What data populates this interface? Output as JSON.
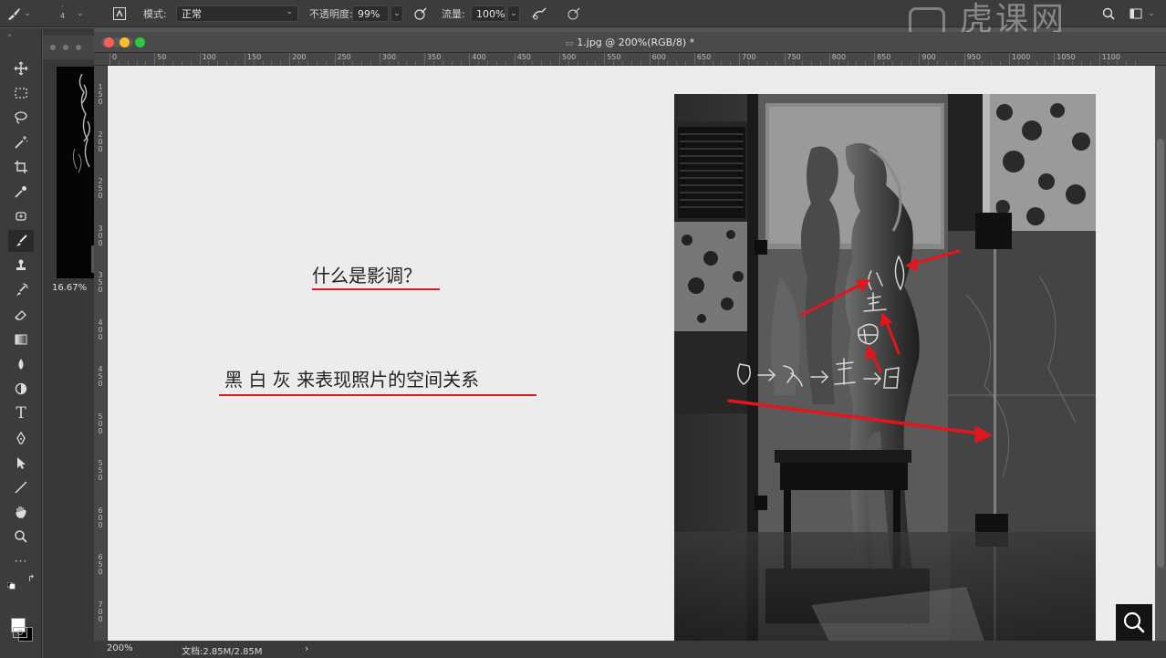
{
  "options_bar": {
    "mode_label": "模式:",
    "mode_value": "正常",
    "opacity_label": "不透明度:",
    "opacity_value": "99%",
    "flow_label": "流量:",
    "flow_value": "100%",
    "brush_size": "4"
  },
  "watermark": "虎课网",
  "document": {
    "title": "1.jpg @ 200%(RGB/8) *",
    "traffic_colors": {
      "close": "#fc5f57",
      "minimize": "#fdbc2e",
      "zoom": "#2ac840"
    }
  },
  "ruler_top": [
    "0",
    "50",
    "100",
    "150",
    "200",
    "250",
    "300",
    "350",
    "400",
    "450",
    "500",
    "550",
    "600",
    "650",
    "700",
    "750",
    "800",
    "850",
    "900",
    "950",
    "1000",
    "1050",
    "1100"
  ],
  "ruler_left": [
    "1 5 0",
    "2 0 0",
    "2 5 0",
    "3 0 0",
    "3 5 0",
    "4 0 0",
    "4 5 0",
    "5 0 0",
    "5 5 0",
    "6 0 0",
    "6 5 0",
    "7 0 0"
  ],
  "navigator": {
    "zoom": "16.67%"
  },
  "slide": {
    "question": "什么是影调？",
    "answer": "黑 白 灰 来表现照片的空间关系",
    "accent_color": "#d8181c",
    "annotation_text": "白→灰→黑→白",
    "annotation_glyphs": [
      "白",
      "黑",
      "白"
    ]
  },
  "status": {
    "zoom": "200%",
    "doc_size": "文档:2.85M/2.85M",
    "arrow": "›"
  },
  "tools": [
    "move-tool",
    "marquee-tool",
    "lasso-tool",
    "magic-wand-tool",
    "crop-tool",
    "eyedropper-tool",
    "healing-brush-tool",
    "brush-tool",
    "clone-stamp-tool",
    "history-brush-tool",
    "eraser-tool",
    "gradient-tool",
    "blur-tool",
    "dodge-tool",
    "type-tool",
    "pen-tool",
    "path-selection-tool",
    "line-tool",
    "hand-tool",
    "zoom-tool",
    "more-tools"
  ]
}
